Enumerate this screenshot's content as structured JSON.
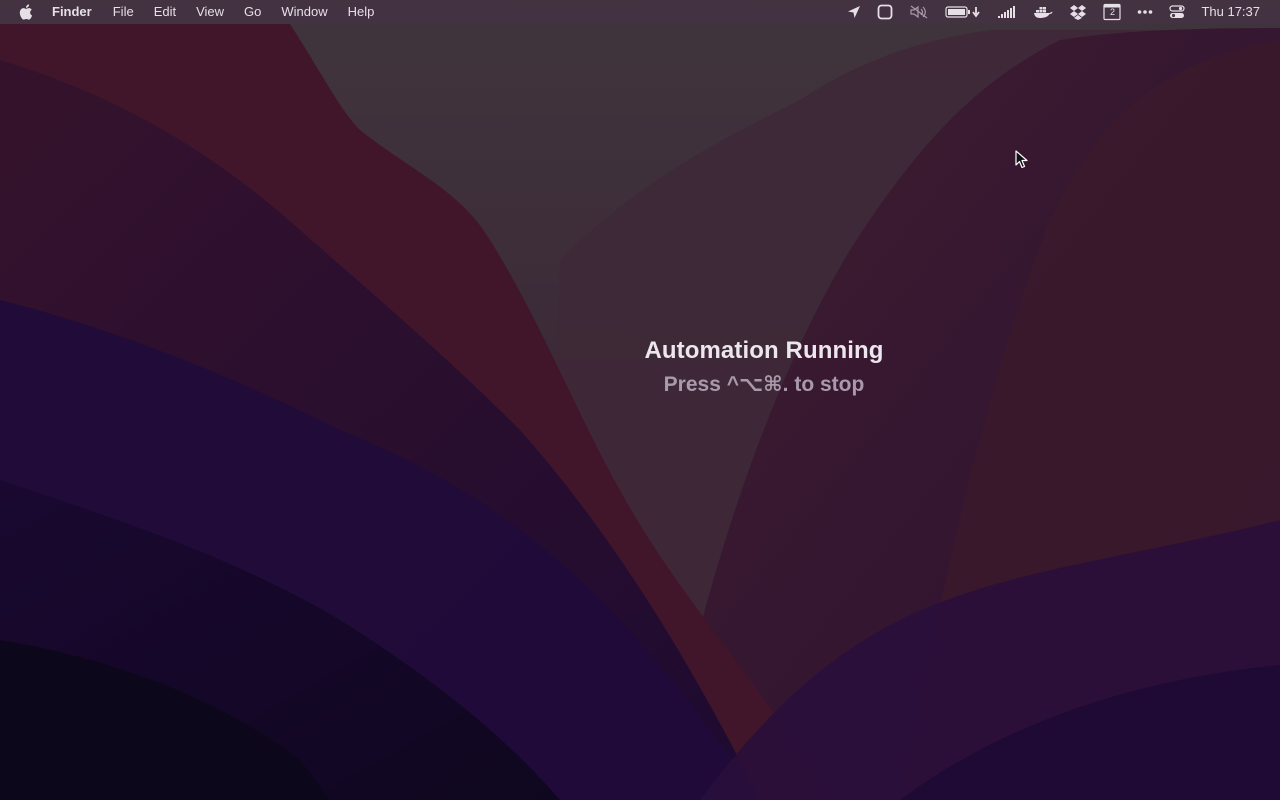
{
  "menubar": {
    "app_name": "Finder",
    "menus": [
      "File",
      "Edit",
      "View",
      "Go",
      "Window",
      "Help"
    ],
    "status_icons": [
      "location-icon",
      "stage-manager-icon",
      "muted-icon",
      "battery-icon",
      "signal-bars-icon",
      "docker-icon",
      "dropbox-icon",
      "calendar-icon",
      "more-icon",
      "control-center-icon"
    ],
    "calendar_day": "2",
    "clock": "Thu 17:37"
  },
  "overlay": {
    "title": "Automation Running",
    "subtitle": "Press ^⌥⌘. to stop"
  },
  "colors": {
    "menubar_text": "#e6dfe6",
    "overlay_title": "#ece6ee",
    "overlay_sub": "#a99aab"
  }
}
